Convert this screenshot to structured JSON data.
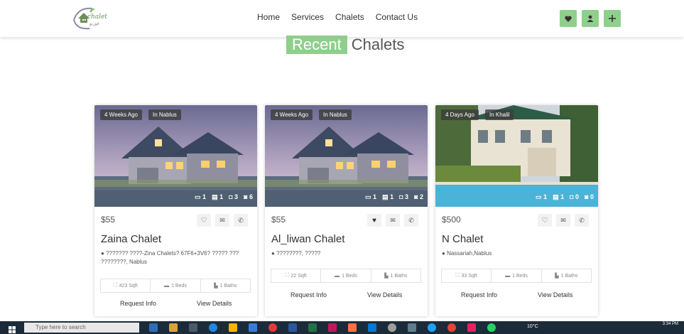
{
  "header": {
    "logo_text": "chalet",
    "logo_subtext": "قورنو",
    "nav": [
      "Home",
      "Services",
      "Chalets",
      "Contact Us"
    ]
  },
  "section_title": {
    "highlight": "Recent",
    "rest": "Chalets"
  },
  "cards": [
    {
      "time_badge": "4 Weeks Ago",
      "location_badge": "In Nablus",
      "stats": [
        "1",
        "1",
        "3",
        "6"
      ],
      "price": "$55",
      "name": "Zaina Chalet",
      "address": "??????? ????-Zina Chalets? 67F6+3V6? ????? ??? ????????, Nablus",
      "area": "423 Sqft",
      "beds": "1 Beds",
      "baths": "1 Baths",
      "request": "Request Info",
      "details": "View Details"
    },
    {
      "time_badge": "4 Weeks Ago",
      "location_badge": "In Nablus",
      "stats": [
        "1",
        "1",
        "3",
        "2"
      ],
      "price": "$55",
      "name": "Al_liwan Chalet",
      "address": "????????, ?????",
      "area": "22 Sqft",
      "beds": "1 Beds",
      "baths": "1 Baths",
      "request": "Request Info",
      "details": "View Details"
    },
    {
      "time_badge": "4 Days Ago",
      "location_badge": "In Khalil",
      "stats": [
        "1",
        "1",
        "0",
        "0"
      ],
      "price": "$500",
      "name": "N Chalet",
      "address": "Nassariah,Nablus",
      "area": "33 Sqft",
      "beds": "1 Beds",
      "baths": "1 Baths",
      "request": "Request Info",
      "details": "View Details"
    }
  ],
  "taskbar": {
    "search_placeholder": "Type here to search",
    "time": "3:34 PM",
    "weather": "10°C"
  },
  "colors": {
    "accent": "#8fcf8c",
    "taskbar": "#1c2b3a"
  }
}
